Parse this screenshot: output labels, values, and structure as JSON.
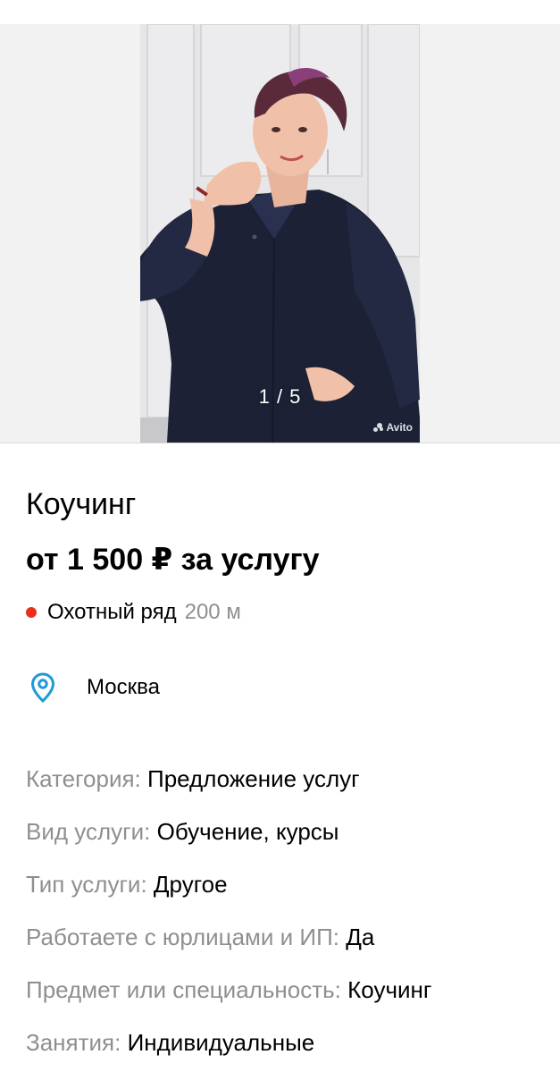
{
  "gallery": {
    "counter": "1 / 5",
    "watermark": "Avito"
  },
  "listing": {
    "title": "Коучинг",
    "price": "от 1 500 ₽ за услугу"
  },
  "metro": {
    "station": "Охотный ряд",
    "distance": "200 м",
    "line_color": "#e8301c"
  },
  "location": {
    "city": "Москва",
    "icon": "location-pin-icon",
    "icon_color": "#1e9bd7"
  },
  "params": [
    {
      "label": "Категория:",
      "value": "Предложение услуг"
    },
    {
      "label": "Вид услуги:",
      "value": "Обучение, курсы"
    },
    {
      "label": "Тип услуги:",
      "value": "Другое"
    },
    {
      "label": "Работаете с юрлицами и ИП:",
      "value": "Да"
    },
    {
      "label": "Предмет или специальность:",
      "value": "Коучинг"
    },
    {
      "label": "Занятия:",
      "value": "Индивидуальные"
    }
  ]
}
